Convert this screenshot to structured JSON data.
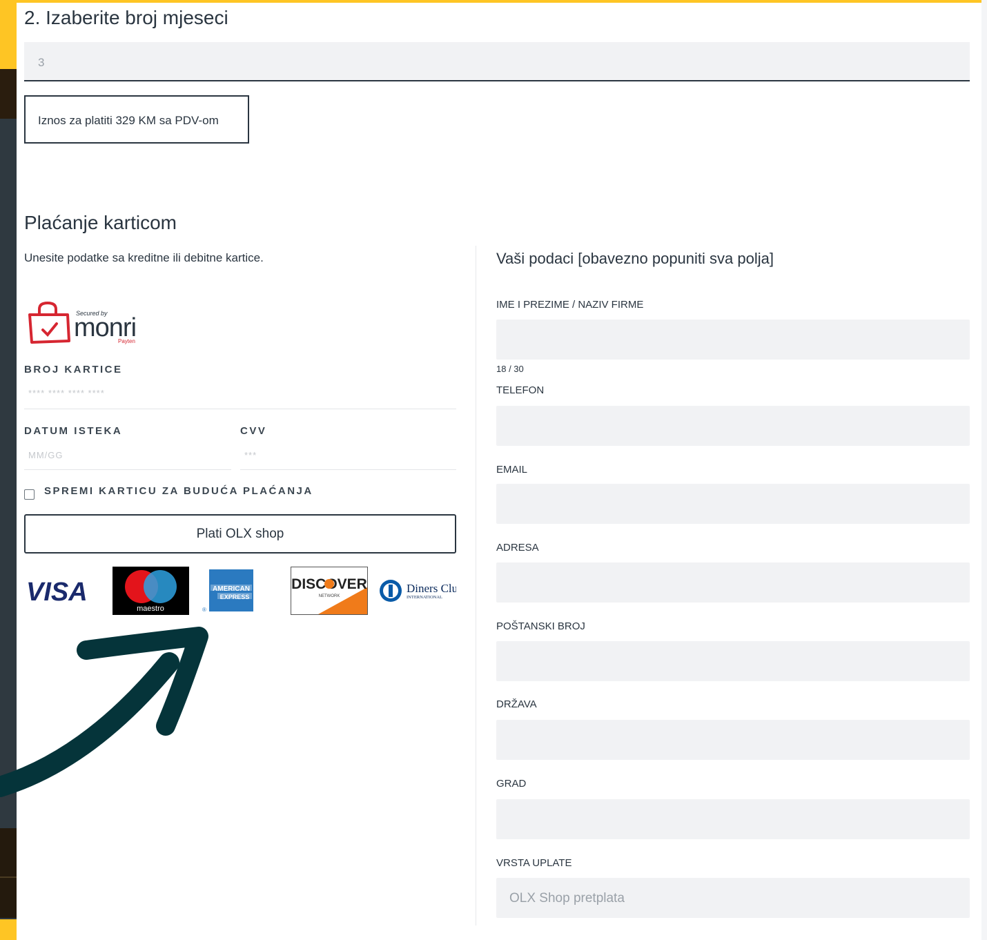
{
  "months_section": {
    "heading": "2. Izaberite broj mjeseci",
    "selected_value": "3",
    "amount_text": "Iznos za platiti 329 KM sa PDV-om"
  },
  "card_payment": {
    "heading": "Plaćanje karticom",
    "subtitle": "Unesite podatke sa kreditne ili debitne kartice.",
    "secured_by": "Secured by",
    "monri_wordmark": "monri",
    "payten": "Payten",
    "card_number_label": "BROJ KARTICE",
    "card_number_placeholder": "**** **** **** ****",
    "expiry_label": "DATUM ISTEKA",
    "expiry_placeholder": "MM/GG",
    "cvv_label": "CVV",
    "cvv_placeholder": "***",
    "save_card_label": "SPREMI KARTICU ZA BUDUĆA PLAĆANJA",
    "pay_button": "Plati OLX shop"
  },
  "brands": {
    "visa": "VISA",
    "maestro": "maestro",
    "amex_line1": "AMERICAN",
    "amex_line2": "EXPRESS",
    "discover": "DISCOVER",
    "discover_sub": "NETWORK",
    "diners_line1": "Diners Club",
    "diners_line2": "INTERNATIONAL"
  },
  "details": {
    "heading": "Vaši podaci [obavezno popuniti sva polja]",
    "name_label": "IME I PREZIME / NAZIV FIRME",
    "name_counter": "18 / 30",
    "phone_label": "TELEFON",
    "email_label": "EMAIL",
    "address_label": "ADRESA",
    "postal_label": "POŠTANSKI BROJ",
    "country_label": "DRŽAVA",
    "city_label": "GRAD",
    "payment_type_label": "VRSTA UPLATE",
    "payment_type_value": "OLX Shop pretplata"
  },
  "colors": {
    "accent_yellow": "#fec524",
    "text_dark": "#2a3540",
    "input_bg": "#f1f2f4",
    "arrow": "#05343a",
    "monri_red": "#d62631"
  }
}
